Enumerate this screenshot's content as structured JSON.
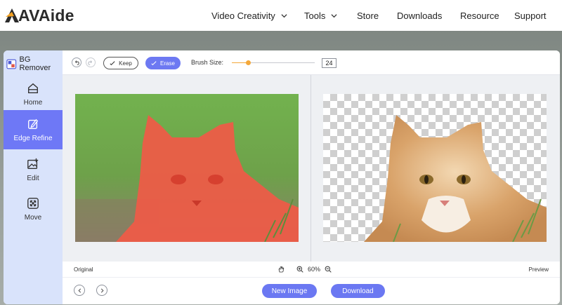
{
  "site": {
    "brand": "AVAide",
    "nav": [
      {
        "label": "Video Creativity",
        "dropdown": true
      },
      {
        "label": "Tools",
        "dropdown": true
      },
      {
        "label": "Store"
      },
      {
        "label": "Downloads"
      },
      {
        "label": "Resource"
      },
      {
        "label": "Support"
      }
    ]
  },
  "app": {
    "title": "BG Remover",
    "sidebar": [
      {
        "label": "Home",
        "icon": "home-icon"
      },
      {
        "label": "Edge Refine",
        "icon": "edge-refine-icon",
        "active": true
      },
      {
        "label": "Edit",
        "icon": "edit-image-icon"
      },
      {
        "label": "Move",
        "icon": "move-icon"
      }
    ],
    "toolbar": {
      "keep": "Keep",
      "erase": "Erase",
      "brush_label": "Brush Size:",
      "brush_size": "24",
      "brush_fraction": 0.2
    },
    "status": {
      "original": "Original",
      "zoom": "60%",
      "preview": "Preview"
    },
    "actions": {
      "new_image": "New Image",
      "download": "Download"
    },
    "colors": {
      "accent": "#6d79f2",
      "sidebar_bg": "#d9e3fb",
      "slider": "#f4a83a",
      "mask": "#ef5a47"
    }
  }
}
